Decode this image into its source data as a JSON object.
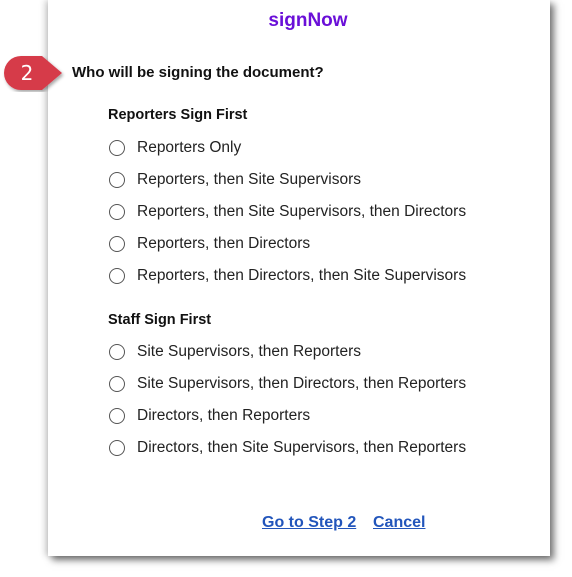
{
  "brand": "signNow",
  "step": {
    "number": "2",
    "question": "Who will be signing the document?",
    "badge_color": "#d63a4a"
  },
  "groups": [
    {
      "title": "Reporters Sign First",
      "options": [
        "Reporters Only",
        "Reporters, then Site Supervisors",
        "Reporters, then Site Supervisors, then Directors",
        "Reporters, then Directors",
        "Reporters, then Directors, then Site Supervisors"
      ]
    },
    {
      "title": "Staff Sign First",
      "options": [
        "Site Supervisors, then Reporters",
        "Site Supervisors, then Directors, then Reporters",
        "Directors, then Reporters",
        "Directors, then Site Supervisors, then Reporters"
      ]
    }
  ],
  "actions": {
    "next": "Go to Step 2",
    "cancel": "Cancel"
  },
  "colors": {
    "brand": "#6a0fd8",
    "link": "#2255bb"
  }
}
